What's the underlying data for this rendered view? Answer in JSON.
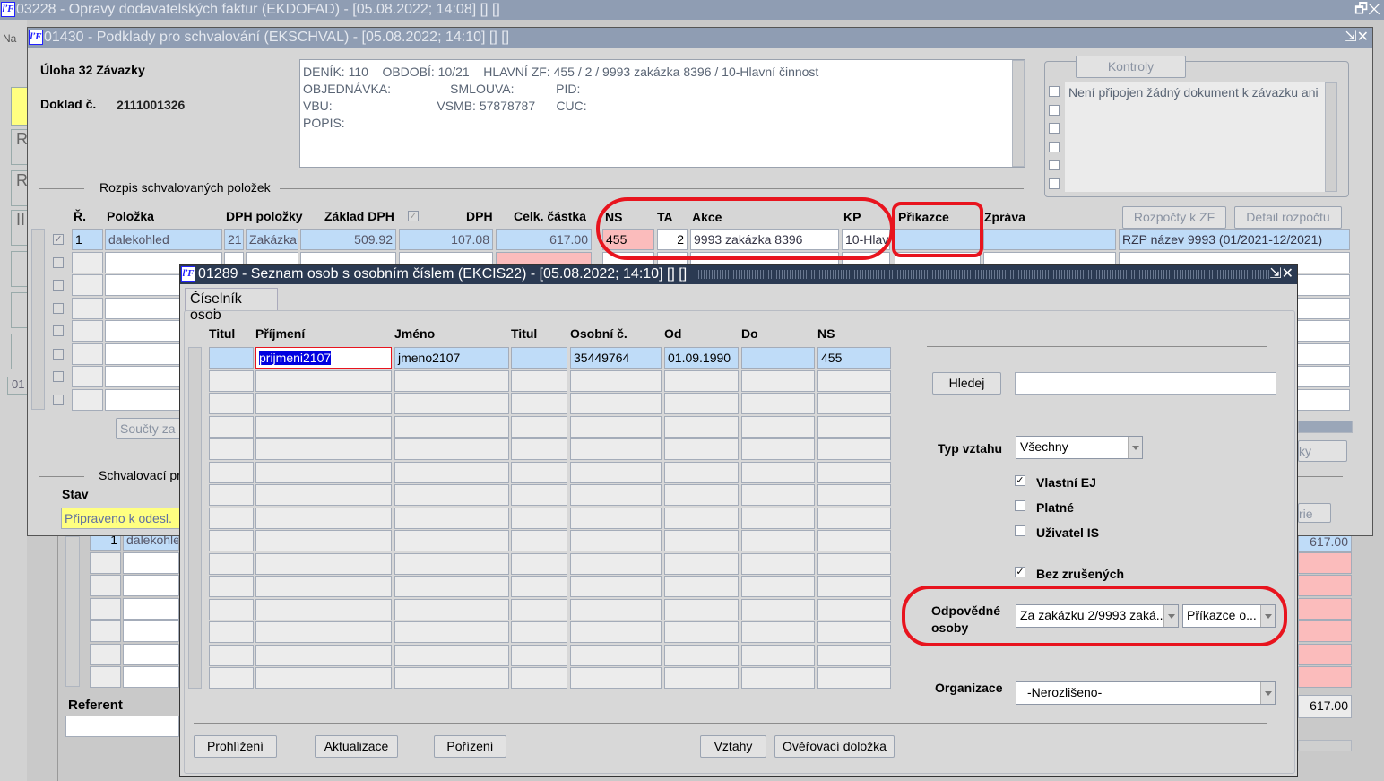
{
  "window1": {
    "title": "03228 - Opravy dodavatelských faktur (EKDOFAD) - [05.08.2022; 14:08]  [] []",
    "side_label": "Na",
    "side_buttons": [
      "R",
      "R",
      "II"
    ],
    "side_code": "01",
    "referent_label": "Referent",
    "lower_row_value": "1",
    "lower_row_text": "dalekohle",
    "lower_total_1": "617.00",
    "lower_total_2": "617.00"
  },
  "window2": {
    "title": "01430 - Podklady pro schvalování (EKSCHVAL) - [05.08.2022; 14:10]  [] []",
    "uloha": "Úloha 32 Závazky",
    "doklad_label": "Doklad č.",
    "doklad_value": "2111001326",
    "info_lines": [
      "DENÍK: 110    OBDOBÍ: 10/21    HLAVNÍ ZF: 455 / 2 / 9993 zakázka 8396 / 10-Hlavní činnost",
      "OBJEDNÁVKA:                 SMLOUVA:            PID:",
      "VBU:                              VSMB: 57878787      CUC:",
      "POPIS:"
    ],
    "kontroly_button": "Kontroly",
    "kontroly_item": "Není připojen žádný dokument k závazku ani s",
    "section_title": "Rozpis schvalovaných položek",
    "columns": [
      "Ř.",
      "Položka",
      "DPH položky",
      "Základ DPH",
      "DPH",
      "Celk. částka",
      "NS",
      "TA",
      "Akce",
      "KP",
      "Příkazce",
      "Zpráva"
    ],
    "rozpocty_button": "Rozpočty k ZF",
    "detail_button": "Detail rozpočtu",
    "row1": {
      "r": "1",
      "polozka": "dalekohled",
      "dph_sazba": "21",
      "dph_typ": "Zakázka",
      "zaklad": "509.92",
      "dph": "107.08",
      "celkem": "617.00",
      "ns": "455",
      "ta": "2",
      "akce": "9993 zakázka 8396",
      "kp": "10-Hlavní",
      "prikazce": "",
      "zprava": "",
      "rzp": "RZP název 9993   (01/2021-12/2021)"
    },
    "soucty_button": "Součty za",
    "schval_section": "Schvalovací pr",
    "stav_label": "Stav",
    "stav_value": "Připraveno k odesl.",
    "right_button_1": "ky",
    "right_button_2": "rie"
  },
  "dialog": {
    "title": "01289 - Seznam osob s osobním číslem (EKCIS22) - [05.08.2022; 14:10]  [] []",
    "tab": "Číselník osob",
    "columns": [
      "Titul",
      "Příjmení",
      "Jméno",
      "Titul",
      "Osobní č.",
      "Od",
      "Do",
      "NS"
    ],
    "rows": [
      {
        "titul1": "",
        "prijmeni": "prijmeni2107",
        "jmeno": "jmeno2107",
        "titul2": "",
        "osobni_cislo": "35449764",
        "od": "01.09.1990",
        "do": "",
        "ns": "455"
      }
    ],
    "hledej_button": "Hledej",
    "search_value": "",
    "typ_vztahu_label": "Typ vztahu",
    "typ_vztahu_value": "Všechny",
    "checkboxes": [
      {
        "label": "Vlastní EJ",
        "checked": true
      },
      {
        "label": "Platné",
        "checked": false
      },
      {
        "label": "Uživatel IS",
        "checked": false
      },
      {
        "label": "Bez zrušených",
        "checked": true
      }
    ],
    "odpovedne_label_1": "Odpovědné",
    "odpovedne_label_2": "osoby",
    "odpovedne_value_1": "Za zakázku 2/9993 zaká...",
    "odpovedne_value_2": "Příkazce o...",
    "organizace_label": "Organizace",
    "organizace_value": "-Nerozlišeno-",
    "buttons": [
      "Prohlížení",
      "Aktualizace",
      "Pořízení",
      "Vztahy",
      "Ověřovací doložka"
    ]
  },
  "colors": {
    "highlight_red": "#e8141e",
    "selection_blue": "#bfdcf8",
    "title_dark": "#2b3a52",
    "status_yellow": "#ffff80"
  }
}
